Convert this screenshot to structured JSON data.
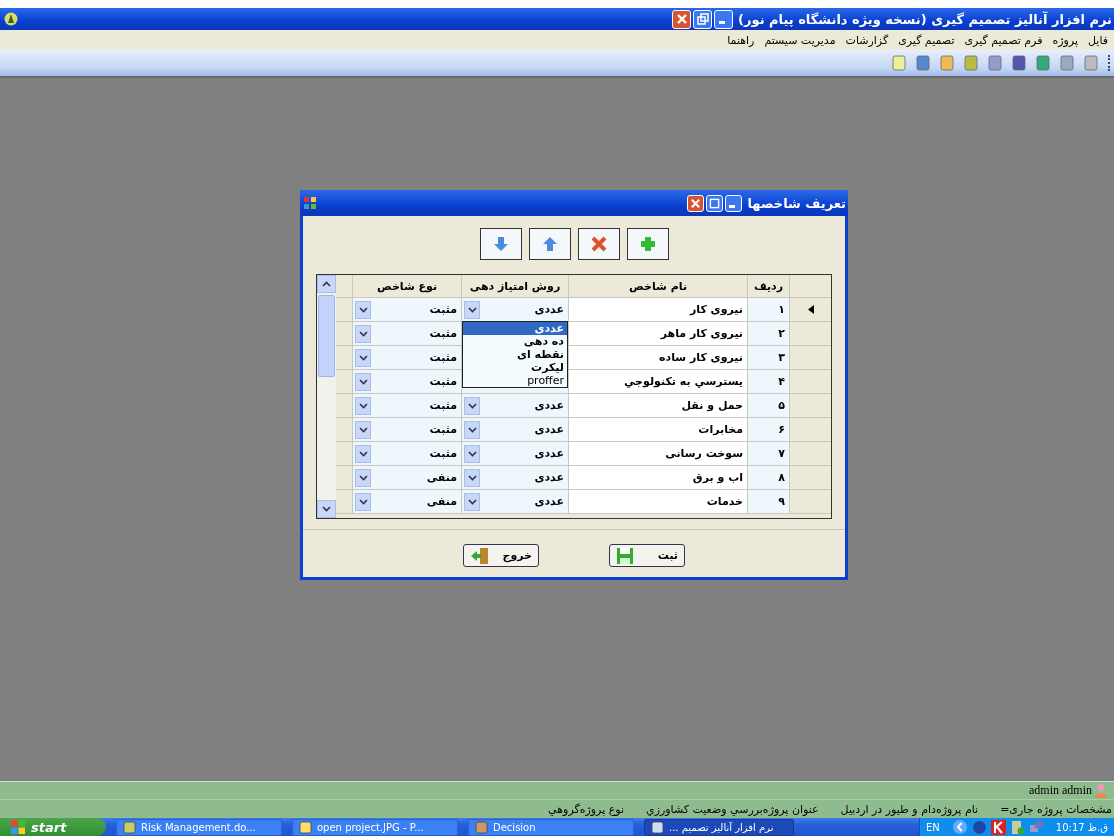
{
  "window": {
    "title": "نرم افزار آنالیز تصمیم گیری (نسخه ویژه دانشگاه پیام نور)"
  },
  "menu": [
    "فایل",
    "پروژه",
    "فرم تصمیم گیری",
    "تصمیم گیری",
    "گزارشات",
    "مدیریت سیستم",
    "راهنما"
  ],
  "dialog": {
    "title": "تعریف شاخصها",
    "columns": [
      "ردیف",
      "نام شاخص",
      "روش امتیاز دهی",
      "نوع شاخص"
    ],
    "rows": [
      {
        "index": "۱",
        "name": "نیروی کار",
        "method": "عددی",
        "type": "مثبت",
        "current": true
      },
      {
        "index": "۲",
        "name": "نیروی کار ماهر",
        "type": "مثبت",
        "current": false
      },
      {
        "index": "۳",
        "name": "نیروی کار ساده",
        "type": "مثبت",
        "current": false
      },
      {
        "index": "۴",
        "name": "یسترسي به تکنولوجي",
        "type": "مثبت",
        "current": false
      },
      {
        "index": "۵",
        "name": "حمل و نقل",
        "method": "عددی",
        "type": "مثبت",
        "current": false
      },
      {
        "index": "۶",
        "name": "مخابرات",
        "method": "عددی",
        "type": "مثبت",
        "current": false
      },
      {
        "index": "۷",
        "name": "سوخت رسانی",
        "method": "عددی",
        "type": "مثبت",
        "current": false
      },
      {
        "index": "۸",
        "name": "اب و برق",
        "method": "عددی",
        "type": "منفی",
        "current": false
      },
      {
        "index": "۹",
        "name": "خدمات",
        "method": "عددی",
        "type": "منفی",
        "current": false
      }
    ],
    "dropdown_options": [
      {
        "label": "عددی",
        "selected": true
      },
      {
        "label": "ده دهی",
        "selected": false
      },
      {
        "label": "نقطه ای",
        "selected": false
      },
      {
        "label": "لیکرت",
        "selected": false
      },
      {
        "label": "proffer",
        "selected": false
      }
    ],
    "buttons": [
      "ثبت",
      "خروج"
    ]
  },
  "user": "admin admin",
  "project_info": [
    "مشخصات پروژه جاری=",
    "نام پروژه‌دام و طیور در اردبیل",
    "عنوان پروژه‌بررسي وضعیت کشاورزي",
    "نوع پروژه‌گروهي"
  ],
  "taskbar": {
    "start": "start",
    "items": [
      {
        "label": "... نرم افزار آنالیز تصمیم",
        "selected": true
      },
      {
        "label": "Decision",
        "selected": false
      },
      {
        "label": "open project.JPG - P...",
        "selected": false
      },
      {
        "label": "Risk Management.do...",
        "selected": false
      }
    ],
    "language": "EN",
    "clock": "10:17 ق.ظ"
  }
}
